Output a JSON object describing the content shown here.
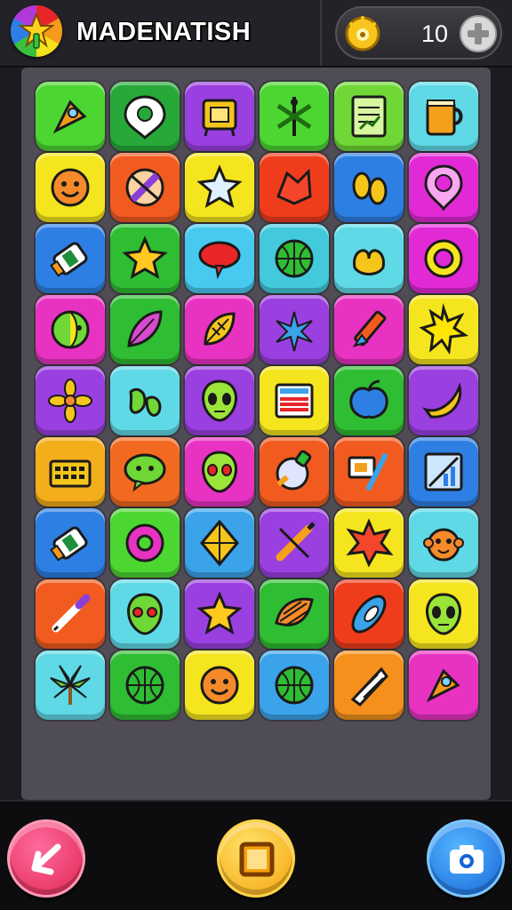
{
  "header": {
    "title": "MADENATISH",
    "coins": "10",
    "logo_icon": "rainbow-star-logo-icon",
    "coin_icon": "gold-coin-icon",
    "add_icon": "plus-icon"
  },
  "board": {
    "rows": 9,
    "cols": 6,
    "tiles": [
      {
        "icon": "rocket",
        "color": "#4cd631"
      },
      {
        "icon": "speech-pin",
        "color": "#27a93a"
      },
      {
        "icon": "robot-frame",
        "color": "#9a3fe0"
      },
      {
        "icon": "dragonfly",
        "color": "#4cd631"
      },
      {
        "icon": "document-chart",
        "color": "#6fd736"
      },
      {
        "icon": "mug",
        "color": "#5fd9e6"
      },
      {
        "icon": "smiley-face",
        "color": "#f5e51e"
      },
      {
        "icon": "pencil-no",
        "color": "#f25b1f"
      },
      {
        "icon": "star-badge",
        "color": "#f5e51e"
      },
      {
        "icon": "leaf-shape",
        "color": "#ef3d1c"
      },
      {
        "icon": "footprints",
        "color": "#2e7fe3"
      },
      {
        "icon": "map-pin",
        "color": "#e12ad6"
      },
      {
        "icon": "tube",
        "color": "#2e7fe3"
      },
      {
        "icon": "star",
        "color": "#2fbd33"
      },
      {
        "icon": "speech-bubble",
        "color": "#47c9f0"
      },
      {
        "icon": "basketball",
        "color": "#43c9dc"
      },
      {
        "icon": "pretzel",
        "color": "#5fd9e6"
      },
      {
        "icon": "ring",
        "color": "#e12ad6"
      },
      {
        "icon": "fruit-ball",
        "color": "#e833c2"
      },
      {
        "icon": "feather-leaf",
        "color": "#2fbd33"
      },
      {
        "icon": "seed-leaf",
        "color": "#e833c2"
      },
      {
        "icon": "palm-star",
        "color": "#9a3fe0"
      },
      {
        "icon": "crayon",
        "color": "#e833c2"
      },
      {
        "icon": "sun-burst",
        "color": "#f5e51e"
      },
      {
        "icon": "flower",
        "color": "#9a3fe0"
      },
      {
        "icon": "peppers",
        "color": "#5fd9e6"
      },
      {
        "icon": "alien-face",
        "color": "#9a3fe0"
      },
      {
        "icon": "striped-box",
        "color": "#f5e51e"
      },
      {
        "icon": "apple",
        "color": "#2fbd33"
      },
      {
        "icon": "banana",
        "color": "#9a3fe0"
      },
      {
        "icon": "keyboard",
        "color": "#f4ad1b"
      },
      {
        "icon": "chat-bubble",
        "color": "#f26a1f"
      },
      {
        "icon": "alien-face-red-eyes",
        "color": "#e833c2"
      },
      {
        "icon": "potion-orb",
        "color": "#f25b1f"
      },
      {
        "icon": "easel-brush",
        "color": "#f25b1f"
      },
      {
        "icon": "chart-frame",
        "color": "#2e7fe3"
      },
      {
        "icon": "tube",
        "color": "#2e7fe3"
      },
      {
        "icon": "donut",
        "color": "#4cd631"
      },
      {
        "icon": "kite",
        "color": "#3aa3ea"
      },
      {
        "icon": "pencil-cross",
        "color": "#9a3fe0"
      },
      {
        "icon": "star-splash",
        "color": "#f5e51e"
      },
      {
        "icon": "monkey-face",
        "color": "#5fd9e6"
      },
      {
        "icon": "pen",
        "color": "#f25b1f"
      },
      {
        "icon": "alien-head",
        "color": "#5fd9e6"
      },
      {
        "icon": "star",
        "color": "#9a3fe0"
      },
      {
        "icon": "shell",
        "color": "#2fbd33"
      },
      {
        "icon": "surfboard",
        "color": "#ef3d1c"
      },
      {
        "icon": "alien-face",
        "color": "#f5e51e"
      },
      {
        "icon": "palm-tree",
        "color": "#5fd9e6"
      },
      {
        "icon": "basketball",
        "color": "#2fbd33"
      },
      {
        "icon": "smiley-face",
        "color": "#f5e51e"
      },
      {
        "icon": "basketball",
        "color": "#3aa3ea"
      },
      {
        "icon": "cone",
        "color": "#f4901b"
      },
      {
        "icon": "rocket",
        "color": "#e833c2"
      }
    ]
  },
  "bottom": {
    "back_icon": "back-arrow-icon",
    "center_icon": "square-icon",
    "camera_icon": "camera-icon"
  }
}
